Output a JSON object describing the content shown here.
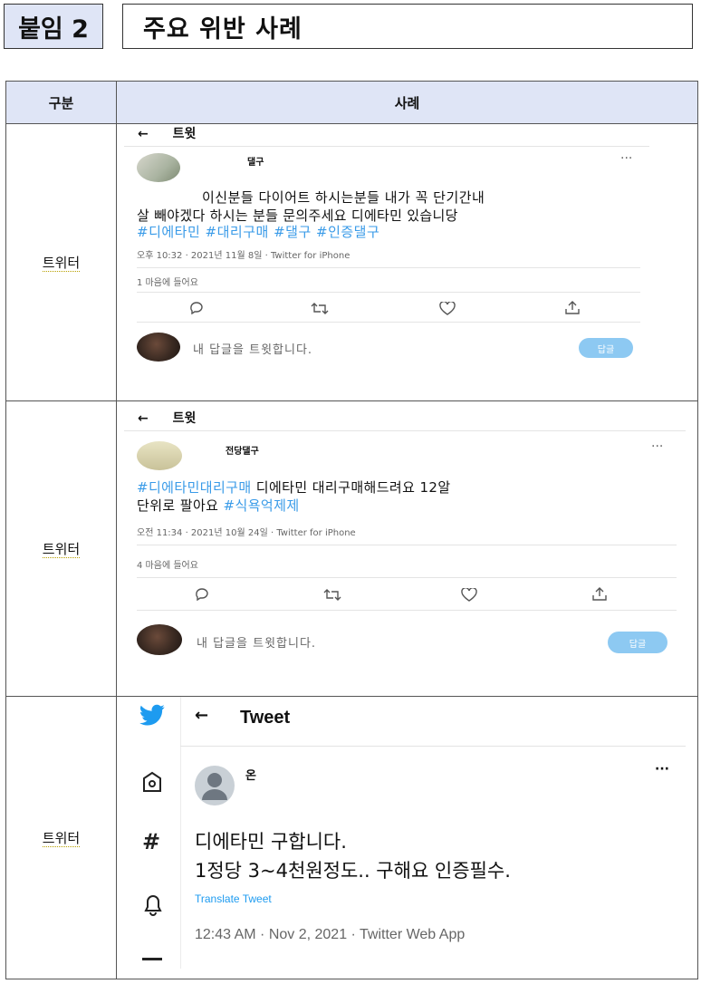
{
  "header": {
    "appendix_label": "붙임 2",
    "title": "주요 위반 사례"
  },
  "table": {
    "col_category": "구분",
    "col_case": "사례",
    "rows": [
      {
        "category": "트위터",
        "tweet": {
          "nav_label": "트윗",
          "username": "댈구",
          "more": "···",
          "line1": "이신분들 다이어트 하시는분들 내가 꼭 단기간내",
          "line2": "살 빼야겠다 하시는 분들 문의주세요 디에타민 있습니당",
          "hashtags": "#디에타민 #대리구매 #댈구 #인증댈구",
          "meta": "오후 10:32 · 2021년 11월 8일 · Twitter for iPhone",
          "likes": "1 마음에 들어요",
          "reply_placeholder": "내 답글을 트윗합니다.",
          "reply_button": "답글"
        }
      },
      {
        "category": "트위터",
        "tweet": {
          "nav_label": "트윗",
          "username": "전당댈구",
          "more": "···",
          "hashtag_lead": "#디에타민대리구매",
          "line1_rest": " 디에타민 대리구매해드려요 12알",
          "line2": "단위로 팔아요 ",
          "hashtag_tail": "#식욕억제제",
          "meta": "오전 11:34 · 2021년 10월 24일 · Twitter for iPhone",
          "likes": "4 마음에 들어요",
          "reply_placeholder": "내 답글을 트윗합니다.",
          "reply_button": "답글"
        }
      },
      {
        "category": "트위터",
        "tweet": {
          "nav_title": "Tweet",
          "username": "온",
          "more": "···",
          "line1": "디에타민 구합니다.",
          "line2": "1정당 3~4천원정도.. 구해요 인증필수.",
          "translate": "Translate Tweet",
          "meta": "12:43 AM · Nov 2, 2021 · Twitter Web App"
        }
      }
    ]
  },
  "colors": {
    "header_fill": "#dfe5f6",
    "twitter_blue": "#1d9bf0",
    "hashtag_blue": "#3a9be8"
  }
}
